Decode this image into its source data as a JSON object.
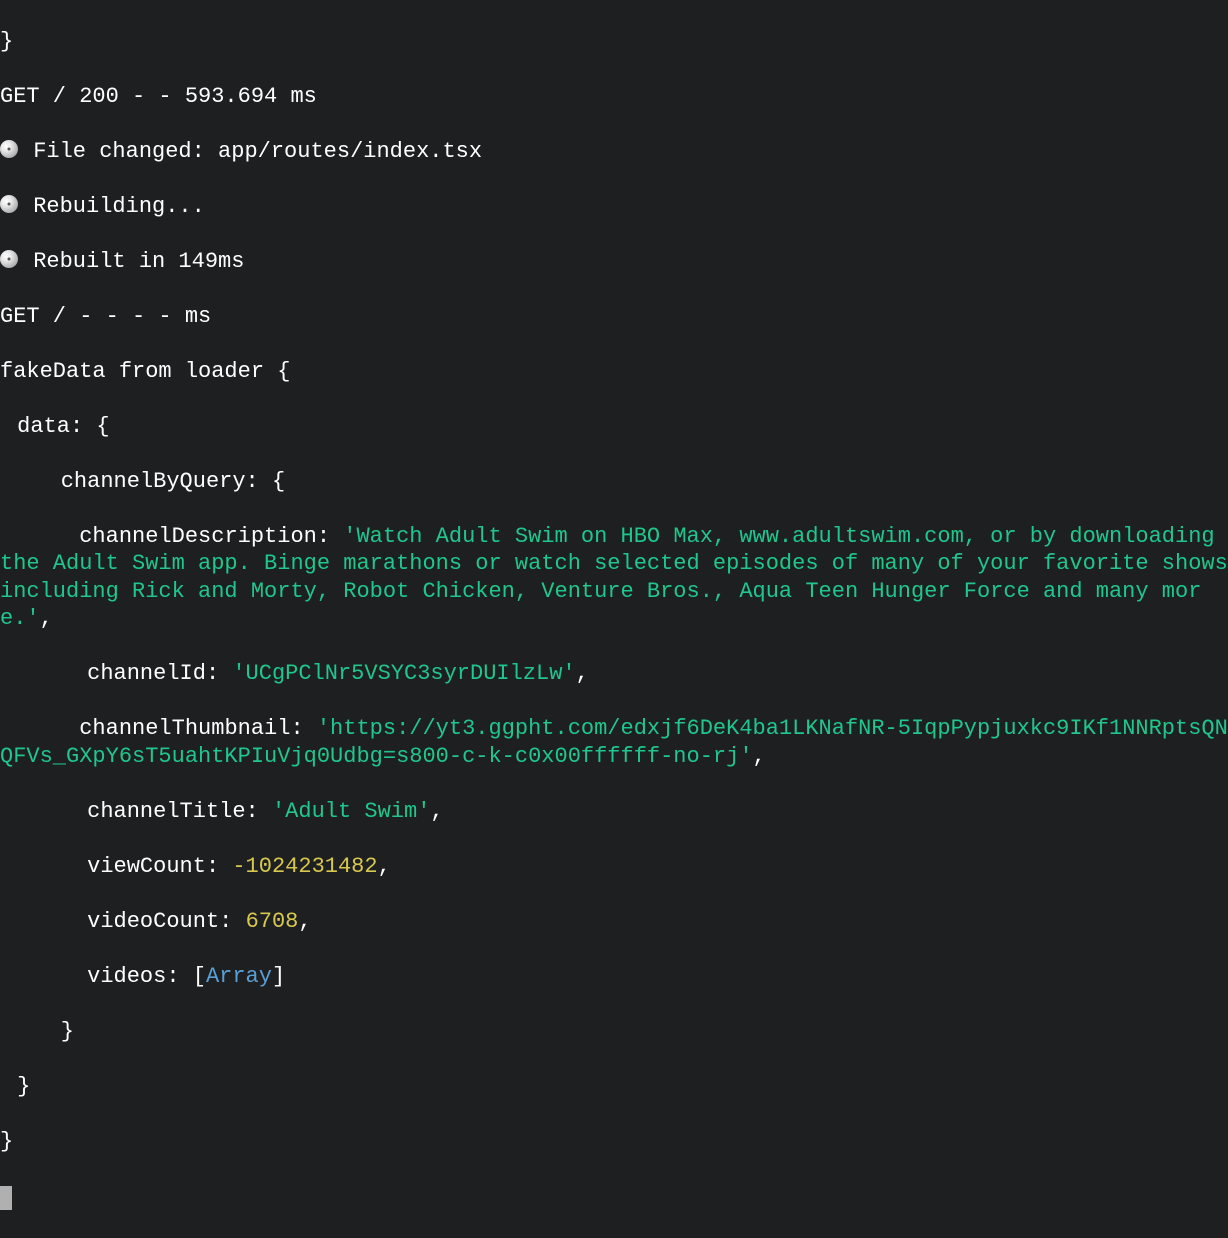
{
  "log": {
    "brace_close_0": "}",
    "get_line_1": "GET / 200 - - 593.694 ms",
    "file_changed_label": " File changed: ",
    "file_changed_path": "app/routes/index.tsx",
    "rebuilding": " Rebuilding...",
    "rebuilt": " Rebuilt in 149ms",
    "get_line_2": "GET / - - - - ms",
    "fakedata_label": "fakeData from loader {",
    "data_label": "data: {",
    "channelByQuery_label": "channelByQuery: {",
    "channelDescription_key": "channelDescription: ",
    "channelDescription_value": "'Watch Adult Swim on HBO Max, www.adultswim.com, or by downloading the Adult Swim app. Binge marathons or watch selected episodes of many of your favorite shows including Rick and Morty, Robot Chicken, Venture Bros., Aqua Teen Hunger Force and many more.'",
    "comma": ",",
    "channelId_key": "channelId: ",
    "channelId_value": "'UCgPClNr5VSYC3syrDUIlzLw'",
    "channelThumbnail_key": "channelThumbnail: ",
    "channelThumbnail_value": "'https://yt3.ggpht.com/edxjf6DeK4ba1LKNafNR-5IqpPypjuxkc9IKf1NNRptsQNQFVs_GXpY6sT5uahtKPIuVjq0Udbg=s800-c-k-c0x00ffffff-no-rj'",
    "channelTitle_key": "channelTitle: ",
    "channelTitle_value": "'Adult Swim'",
    "viewCount_key": "viewCount: ",
    "viewCount_value": "-1024231482",
    "videoCount_key": "videoCount: ",
    "videoCount_value": "6708",
    "videos_key": "videos: ",
    "videos_open": "[",
    "videos_array": "Array",
    "videos_close": "]",
    "brace_close_3": "}",
    "brace_close_2": "}",
    "brace_close_1": "}"
  }
}
